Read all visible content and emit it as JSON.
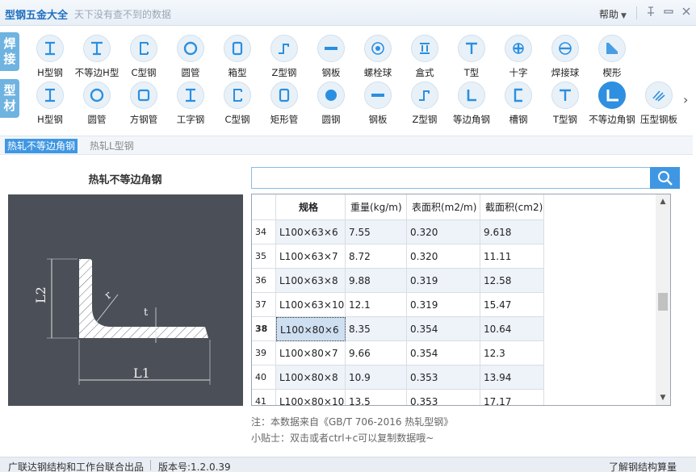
{
  "app": {
    "title": "型钢五金大全",
    "subtitle": "天下没有查不到的数据",
    "help": "帮助",
    "pin_icon": "pin-icon",
    "min_icon": "minimize-icon",
    "close_icon": "close-icon"
  },
  "categories": [
    {
      "tag": "焊接",
      "items": [
        {
          "label": "H型钢",
          "icon": "h-beam-icon"
        },
        {
          "label": "不等边H型",
          "icon": "unequal-h-icon"
        },
        {
          "label": "C型钢",
          "icon": "c-channel-icon"
        },
        {
          "label": "圆管",
          "icon": "round-tube-icon"
        },
        {
          "label": "箱型",
          "icon": "box-icon"
        },
        {
          "label": "Z型钢",
          "icon": "z-section-icon"
        },
        {
          "label": "钢板",
          "icon": "plate-icon"
        },
        {
          "label": "螺栓球",
          "icon": "bolt-ball-icon"
        },
        {
          "label": "盒式",
          "icon": "box-type-icon"
        },
        {
          "label": "T型",
          "icon": "t-section-icon"
        },
        {
          "label": "十字",
          "icon": "cross-icon"
        },
        {
          "label": "焊接球",
          "icon": "welded-ball-icon"
        },
        {
          "label": "楔形",
          "icon": "wedge-icon"
        }
      ]
    },
    {
      "tag": "型材",
      "items": [
        {
          "label": "H型钢",
          "icon": "h-beam-icon"
        },
        {
          "label": "圆管",
          "icon": "round-tube-icon"
        },
        {
          "label": "方钢管",
          "icon": "square-tube-icon"
        },
        {
          "label": "工字钢",
          "icon": "i-beam-icon"
        },
        {
          "label": "C型钢",
          "icon": "c-channel-icon"
        },
        {
          "label": "矩形管",
          "icon": "rect-tube-icon"
        },
        {
          "label": "圆钢",
          "icon": "round-bar-icon"
        },
        {
          "label": "钢板",
          "icon": "plate-icon"
        },
        {
          "label": "Z型钢",
          "icon": "z-section-icon"
        },
        {
          "label": "等边角钢",
          "icon": "equal-angle-icon"
        },
        {
          "label": "槽钢",
          "icon": "channel-icon"
        },
        {
          "label": "T型钢",
          "icon": "t-section-icon"
        },
        {
          "label": "不等边角钢",
          "icon": "unequal-angle-icon"
        },
        {
          "label": "压型钢板",
          "icon": "profiled-sheet-icon"
        }
      ]
    }
  ],
  "next_icon": "chevron-right-icon",
  "tabs": [
    {
      "label": "热轧不等边角钢",
      "active": true
    },
    {
      "label": "热轧L型钢",
      "active": false
    }
  ],
  "diagram": {
    "title": "热轧不等边角钢",
    "label_l1": "L1",
    "label_l2": "L2",
    "label_r": "r",
    "label_t": "t"
  },
  "search": {
    "value": "",
    "placeholder": "",
    "icon": "search-icon"
  },
  "table": {
    "headers": [
      "规格",
      "重量(kg/m)",
      "表面积(m2/m)",
      "截面积(cm2)"
    ],
    "rows": [
      {
        "idx": "34",
        "spec": "L100×63×6",
        "weight": "7.55",
        "surface": "0.320",
        "area": "9.618"
      },
      {
        "idx": "35",
        "spec": "L100×63×7",
        "weight": "8.72",
        "surface": "0.320",
        "area": "11.11"
      },
      {
        "idx": "36",
        "spec": "L100×63×8",
        "weight": "9.88",
        "surface": "0.319",
        "area": "12.58"
      },
      {
        "idx": "37",
        "spec": "L100×63×10",
        "weight": "12.1",
        "surface": "0.319",
        "area": "15.47"
      },
      {
        "idx": "38",
        "spec": "L100×80×6",
        "weight": "8.35",
        "surface": "0.354",
        "area": "10.64"
      },
      {
        "idx": "39",
        "spec": "L100×80×7",
        "weight": "9.66",
        "surface": "0.354",
        "area": "12.3"
      },
      {
        "idx": "40",
        "spec": "L100×80×8",
        "weight": "10.9",
        "surface": "0.353",
        "area": "13.94"
      },
      {
        "idx": "41",
        "spec": "L100×80×10",
        "weight": "13.5",
        "surface": "0.353",
        "area": "17.17"
      }
    ],
    "selected_idx": "38"
  },
  "notes": {
    "source": "注：本数据来自《GB/T 706-2016 热轧型钢》",
    "tip": "小贴士：双击或者ctrl+c可以复制数据哦~"
  },
  "status": {
    "left": "广联达钢结构和工作台联合出品",
    "version": "版本号:1.2.0.39",
    "right": "了解钢结构算量"
  },
  "colors": {
    "accent": "#3f97e3",
    "tag": "#6fb3e0",
    "diagram_bg": "#4b5058"
  }
}
